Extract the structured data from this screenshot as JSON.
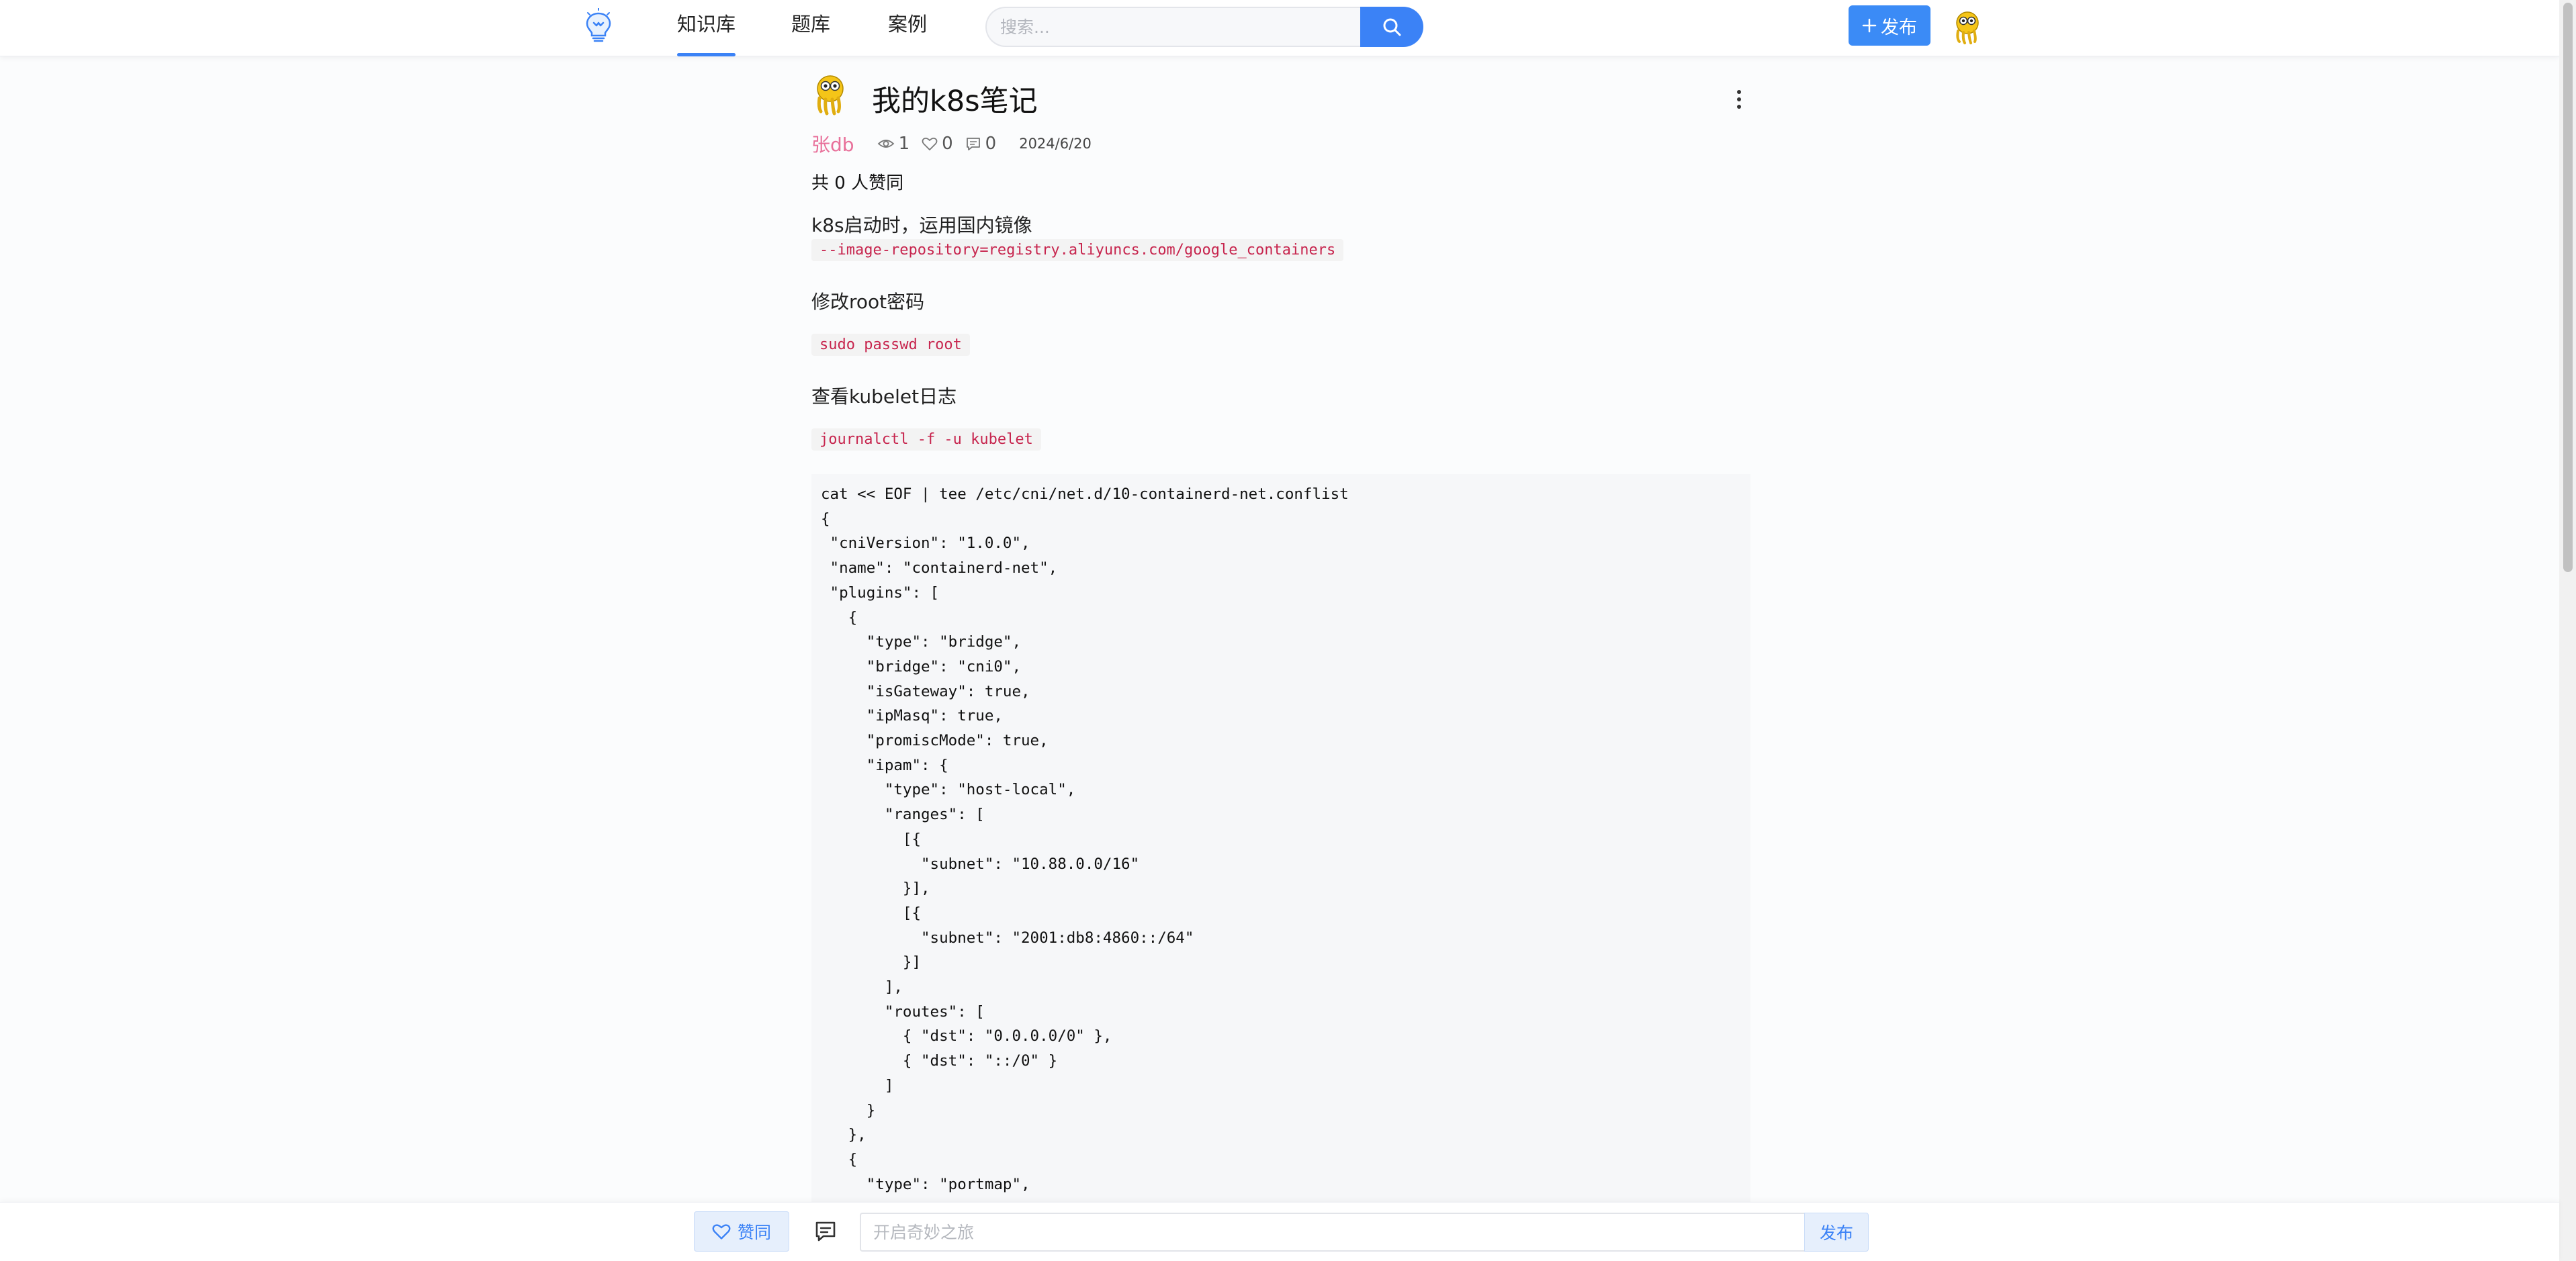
{
  "nav": {
    "tabs": [
      {
        "label": "知识库",
        "active": true
      },
      {
        "label": "题库",
        "active": false
      },
      {
        "label": "案例",
        "active": false
      }
    ],
    "search": {
      "placeholder": "搜索...",
      "value": ""
    },
    "publish_label": "发布",
    "publish_icon": "plus-icon",
    "accent_color": "#3b82f6"
  },
  "article": {
    "title": "我的k8s笔记",
    "author": "张db",
    "views": "1",
    "likes": "0",
    "comments": "0",
    "date": "2024/6/20",
    "like_summary": "共 0 人赞同",
    "blocks": [
      {
        "text": "k8s启动时，运用国内镜像"
      },
      {
        "code": "--image-repository=registry.aliyuncs.com/google_containers"
      },
      {
        "text": "修改root密码"
      },
      {
        "code": "sudo passwd root"
      },
      {
        "text": "查看kubelet日志"
      },
      {
        "code": "journalctl -f -u kubelet"
      }
    ],
    "code_block": "cat << EOF | tee /etc/cni/net.d/10-containerd-net.conflist\n{\n \"cniVersion\": \"1.0.0\",\n \"name\": \"containerd-net\",\n \"plugins\": [\n   {\n     \"type\": \"bridge\",\n     \"bridge\": \"cni0\",\n     \"isGateway\": true,\n     \"ipMasq\": true,\n     \"promiscMode\": true,\n     \"ipam\": {\n       \"type\": \"host-local\",\n       \"ranges\": [\n         [{\n           \"subnet\": \"10.88.0.0/16\"\n         }],\n         [{\n           \"subnet\": \"2001:db8:4860::/64\"\n         }]\n       ],\n       \"routes\": [\n         { \"dst\": \"0.0.0.0/0\" },\n         { \"dst\": \"::/0\" }\n       ]\n     }\n   },\n   {\n     \"type\": \"portmap\","
  },
  "bottom": {
    "like_label": "赞同",
    "comment_placeholder": "开启奇妙之旅",
    "submit_label": "发布"
  }
}
